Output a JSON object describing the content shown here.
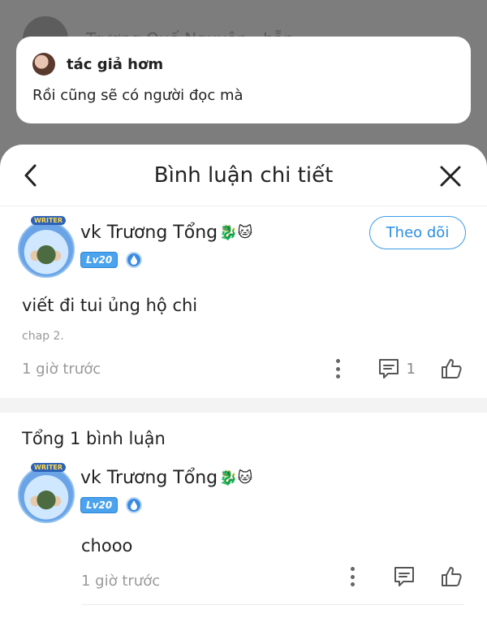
{
  "background": {
    "behind_text": "Trương Quế Nguyên - hẵn"
  },
  "toast": {
    "name": "tác giả hơm",
    "message": "Rồi cũng sẽ có người đọc mà"
  },
  "sheet": {
    "title": "Bình luận chi tiết"
  },
  "main_comment": {
    "user": "vk Trương Tổng",
    "emojis": "🐉🐱",
    "level": "Lv20",
    "avatar_tag": "WRITER",
    "follow_label": "Theo dõi",
    "text": "viết đi tui ủng hộ chi",
    "chapter": "chap 2.",
    "time": "1 giờ trước",
    "reply_count": "1"
  },
  "total_label": "Tổng 1 bình luận",
  "reply": {
    "user": "vk Trương Tổng",
    "emojis": "🐉🐱",
    "level": "Lv20",
    "avatar_tag": "WRITER",
    "text": "chooo",
    "time": "1 giờ trước"
  },
  "colors": {
    "accent": "#3a9be8",
    "overlay": "#7d7d7d",
    "muted": "#999999"
  }
}
